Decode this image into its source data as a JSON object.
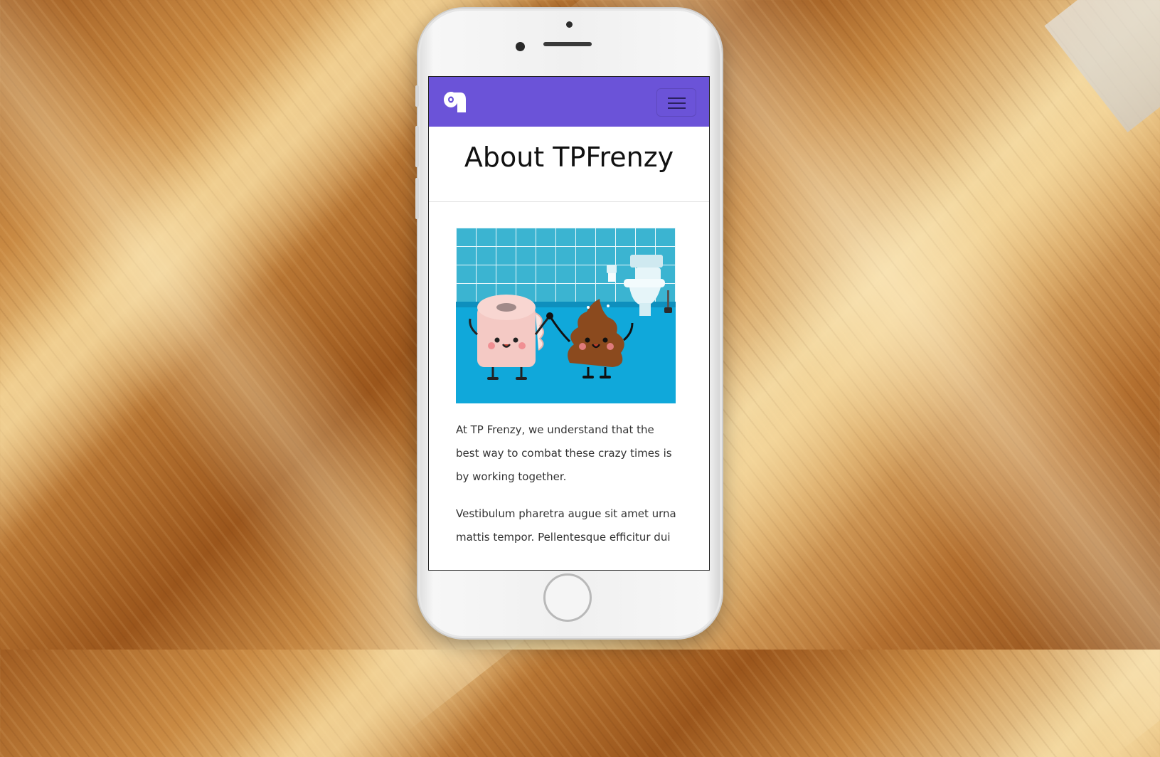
{
  "page": {
    "title": "About TPFrenzy",
    "paragraphs": [
      "At TP Frenzy, we understand that the best way to combat these crazy times is by working together.",
      "Vestibulum pharetra augue sit amet urna mattis tempor. Pellentesque efficitur dui"
    ]
  },
  "navbar": {
    "brand_icon": "toilet-paper-icon",
    "menu_icon": "hamburger-icon",
    "color": "#6b53d8"
  },
  "illustration": {
    "subject": "toilet-paper-and-poop-characters-in-bathroom",
    "colors": {
      "tiles": "#3bb4d1",
      "floor": "#0fa6d8",
      "poop": "#8b4a1e",
      "paper": "#f4c9c4"
    }
  }
}
